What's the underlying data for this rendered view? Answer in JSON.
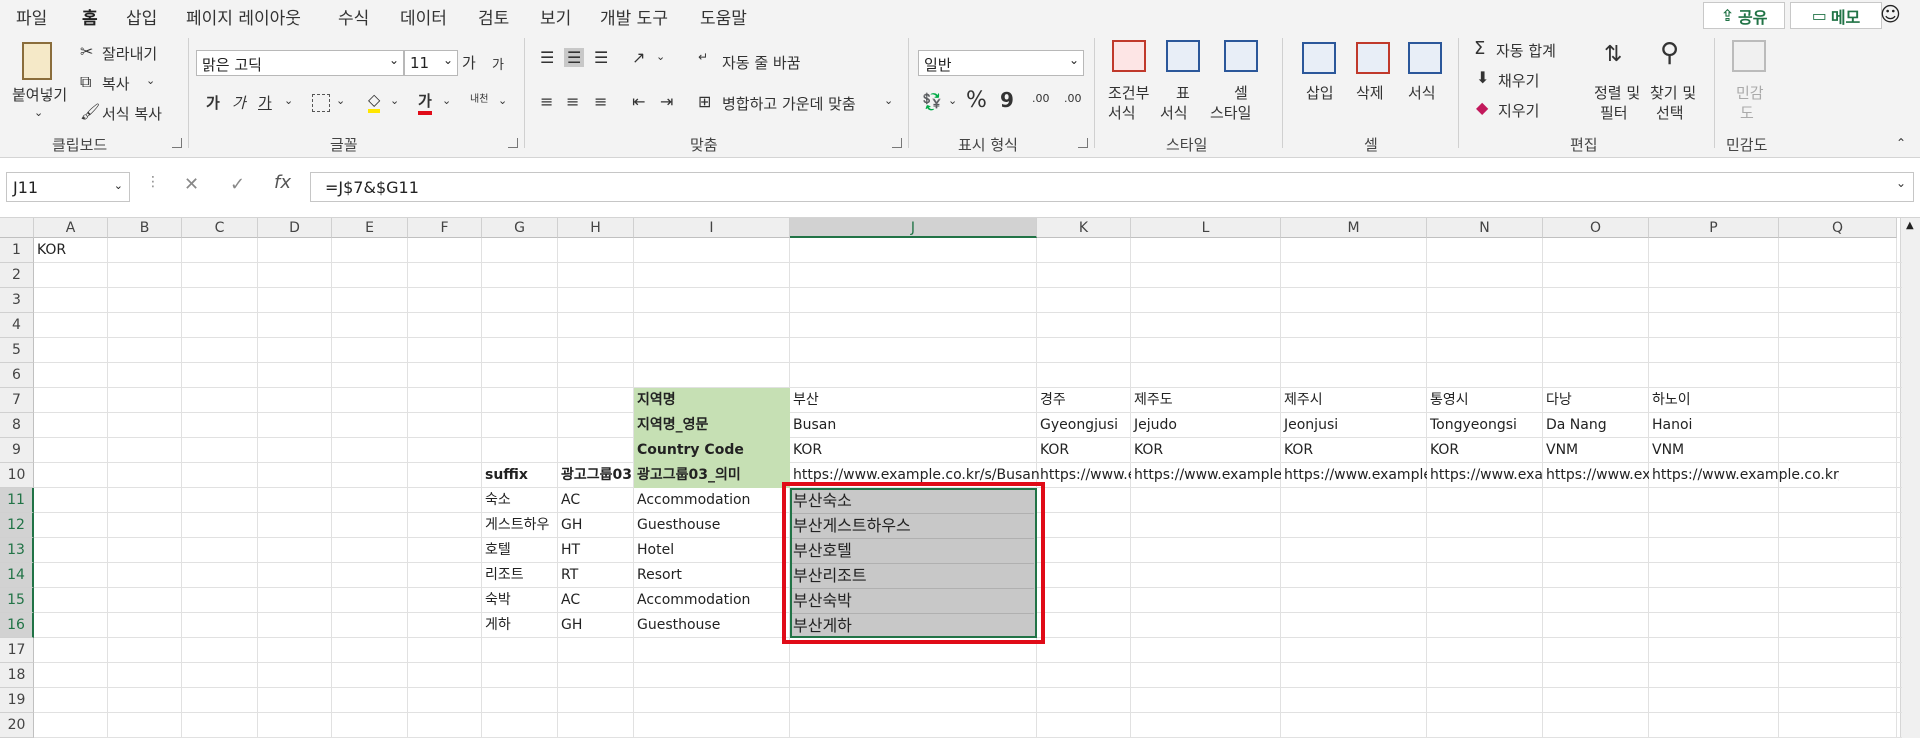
{
  "tabs": [
    "파일",
    "홈",
    "삽입",
    "페이지 레이아웃",
    "수식",
    "데이터",
    "검토",
    "보기",
    "개발 도구",
    "도움말"
  ],
  "active_tab": "홈",
  "top_right": {
    "share": "공유",
    "memo": "메모",
    "share_icon": "share-icon",
    "memo_icon": "memo-icon",
    "smiley": "feedback-smiley-icon"
  },
  "ribbon": {
    "clipboard": {
      "paste": "붙여넣기",
      "cut": "잘라내기",
      "copy": "복사",
      "format_painter": "서식 복사",
      "group": "클립보드"
    },
    "font": {
      "name": "맑은 고딕",
      "size": "11",
      "grow": "가",
      "shrink": "가",
      "bold": "가",
      "italic": "가",
      "underline": "가",
      "font_color": "가",
      "phonetic": "내천",
      "group": "글꼴"
    },
    "alignment": {
      "wrap": "자동 줄 바꿈",
      "merge": "병합하고 가운데 맞춤",
      "group": "맞춤"
    },
    "number": {
      "format": "일반",
      "percent": "%",
      "comma": "9",
      "inc_decimal": ".00",
      "dec_decimal": ".00",
      "group": "표시 형식"
    },
    "styles": {
      "conditional_1": "조건부",
      "conditional_2": "서식",
      "table_1": "표",
      "table_2": "서식",
      "cell_1": "셀",
      "cell_2": "스타일",
      "group": "스타일"
    },
    "cells": {
      "insert": "삽입",
      "delete": "삭제",
      "format": "서식",
      "group": "셀"
    },
    "editing": {
      "autosum": "자동 합계",
      "fill": "채우기",
      "clear": "지우기",
      "sort_1": "정렬 및",
      "sort_2": "필터",
      "find_1": "찾기 및",
      "find_2": "선택",
      "group": "편집"
    },
    "sensitivity": {
      "label_1": "민감",
      "label_2": "도",
      "group": "민감도"
    }
  },
  "formula_bar": {
    "name_box": "J11",
    "formula": "=J$7&$G11",
    "cancel": "✕",
    "enter": "✓",
    "fx": "fx"
  },
  "columns": [
    "A",
    "B",
    "C",
    "D",
    "E",
    "F",
    "G",
    "H",
    "I",
    "J",
    "K",
    "L",
    "M",
    "N",
    "O",
    "P",
    "Q"
  ],
  "selected_column": "J",
  "rows": [
    "1",
    "2",
    "3",
    "4",
    "5",
    "6",
    "7",
    "8",
    "9",
    "10",
    "11",
    "12",
    "13",
    "14",
    "15",
    "16",
    "17",
    "18",
    "19",
    "20"
  ],
  "selected_rows": [
    "11",
    "12",
    "13",
    "14",
    "15",
    "16"
  ],
  "cells": {
    "A1": "KOR",
    "I7": "지역명",
    "J7": "부산",
    "K7": "경주",
    "L7": "제주도",
    "M7": "제주시",
    "N7": "통영시",
    "O7": "다낭",
    "P7": "하노이",
    "I8": "지역명_영문",
    "J8": "Busan",
    "K8": "Gyeongjusi",
    "L8": "Jejudo",
    "M8": "Jeonjusi",
    "N8": "Tongyeongsi",
    "O8": "Da Nang",
    "P8": "Hanoi",
    "I9": "Country Code",
    "J9": "KOR",
    "K9": "KOR",
    "L9": "KOR",
    "M9": "KOR",
    "N9": "KOR",
    "O9": "VNM",
    "P9": "VNM",
    "G10": "suffix",
    "H10": "광고그룹03",
    "I10": "광고그룹03_의미",
    "J10": "https://www.example.co.kr/s/Busan",
    "K10": "https://www.ex",
    "L10": "https://www.example.co",
    "M10": "https://www.example.c",
    "N10": "https://www.exam",
    "O10": "https://www.exa",
    "P10": "https://www.example.co.kr/s/Hanoi",
    "G11": "숙소",
    "H11": "AC",
    "I11": "Accommodation",
    "J11": "부산숙소",
    "G12": "게스트하우",
    "H12": "GH",
    "I12": "Guesthouse",
    "J12": "부산게스트하우스",
    "G13": "호텔",
    "H13": "HT",
    "I13": "Hotel",
    "J13": "부산호텔",
    "G14": "리조트",
    "H14": "RT",
    "I14": "Resort",
    "J14": "부산리조트",
    "G15": "숙박",
    "H15": "AC",
    "I15": "Accommodation",
    "J15": "부산숙박",
    "G16": "게하",
    "H16": "GH",
    "I16": "Guesthouse",
    "J16": "부산게하"
  }
}
